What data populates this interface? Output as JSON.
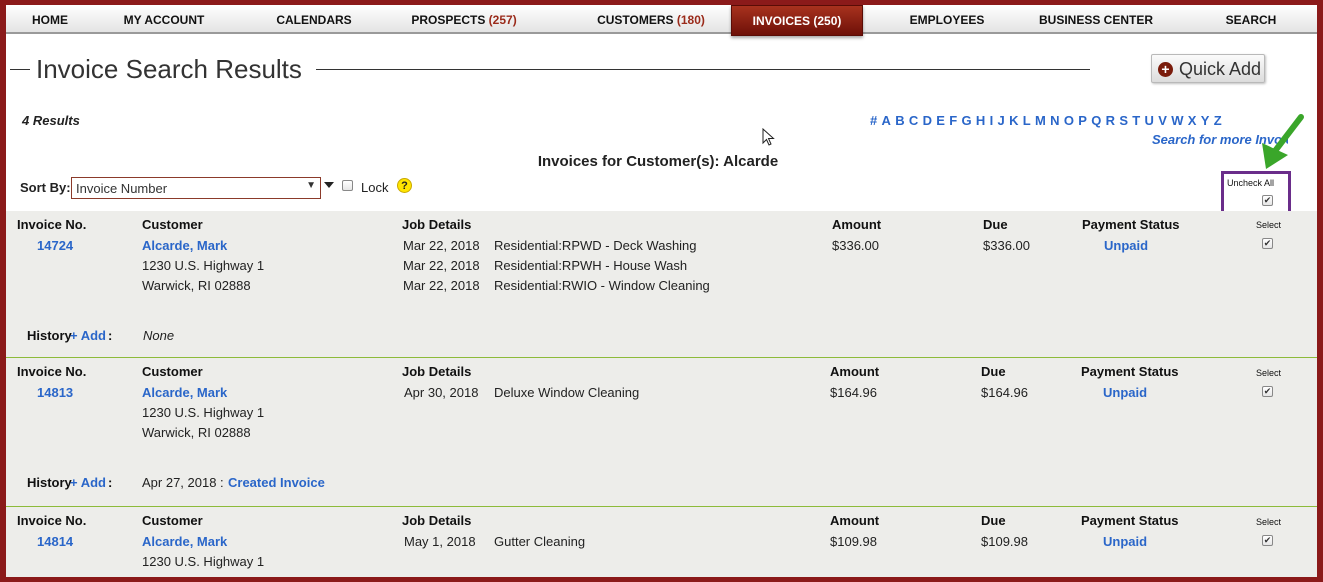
{
  "nav": [
    {
      "label": "HOME",
      "count": ""
    },
    {
      "label": "MY ACCOUNT",
      "count": ""
    },
    {
      "label": "CALENDARS",
      "count": ""
    },
    {
      "label": "PROSPECTS",
      "count": "(257)"
    },
    {
      "label": "CUSTOMERS",
      "count": "(180)"
    },
    {
      "label": "INVOICES",
      "count": "(250)"
    },
    {
      "label": "EMPLOYEES",
      "count": ""
    },
    {
      "label": "BUSINESS CENTER",
      "count": ""
    },
    {
      "label": "SEARCH",
      "count": ""
    }
  ],
  "active_tab": "INVOICES",
  "page_title": "Invoice Search Results",
  "quick_add_label": "Quick Add",
  "results_count": "4 Results",
  "alphabet": [
    "#",
    "A",
    "B",
    "C",
    "D",
    "E",
    "F",
    "G",
    "H",
    "I",
    "J",
    "K",
    "L",
    "M",
    "N",
    "O",
    "P",
    "Q",
    "R",
    "S",
    "T",
    "U",
    "V",
    "W",
    "X",
    "Y",
    "Z"
  ],
  "search_more": "Search for more Invoices",
  "customer_heading": "Invoices for Customer(s): Alcarde",
  "sort": {
    "label": "Sort By:",
    "value": "Invoice Number",
    "lock_label": "Lock",
    "help": "?"
  },
  "uncheck_all_label": "Uncheck All",
  "columns": {
    "invoice_no": "Invoice No.",
    "customer": "Customer",
    "job_details": "Job Details",
    "amount": "Amount",
    "due": "Due",
    "payment_status": "Payment Status",
    "select": "Select"
  },
  "history_label": "History",
  "add_label": "+ Add",
  "invoices": [
    {
      "number": "14724",
      "customer_name": "Alcarde, Mark",
      "address1": "1230 U.S. Highway 1",
      "address2": "Warwick, RI 02888",
      "jobs": [
        {
          "date": "Mar 22, 2018",
          "desc": "Residential:RPWD - Deck Washing"
        },
        {
          "date": "Mar 22, 2018",
          "desc": "Residential:RPWH - House Wash"
        },
        {
          "date": "Mar 22, 2018",
          "desc": "Residential:RWIO - Window Cleaning"
        }
      ],
      "amount": "$336.00",
      "due": "$336.00",
      "status": "Unpaid",
      "history_date": "None",
      "history_link": ""
    },
    {
      "number": "14813",
      "customer_name": "Alcarde, Mark",
      "address1": "1230 U.S. Highway 1",
      "address2": "Warwick, RI 02888",
      "jobs": [
        {
          "date": "Apr 30, 2018",
          "desc": "Deluxe Window Cleaning"
        }
      ],
      "amount": "$164.96",
      "due": "$164.96",
      "status": "Unpaid",
      "history_date": "Apr 27, 2018 :",
      "history_link": "Created Invoice"
    },
    {
      "number": "14814",
      "customer_name": "Alcarde, Mark",
      "address1": "1230 U.S. Highway 1",
      "address2": "",
      "jobs": [
        {
          "date": "May 1, 2018",
          "desc": "Gutter Cleaning"
        }
      ],
      "amount": "$109.98",
      "due": "$109.98",
      "status": "Unpaid",
      "history_date": "",
      "history_link": ""
    }
  ],
  "colors": {
    "brand": "#8b1a1a",
    "link": "#2a66c9",
    "highlight_box": "#6a2d8a",
    "arrow": "#3aa62a",
    "separator": "#8dbb3a"
  }
}
